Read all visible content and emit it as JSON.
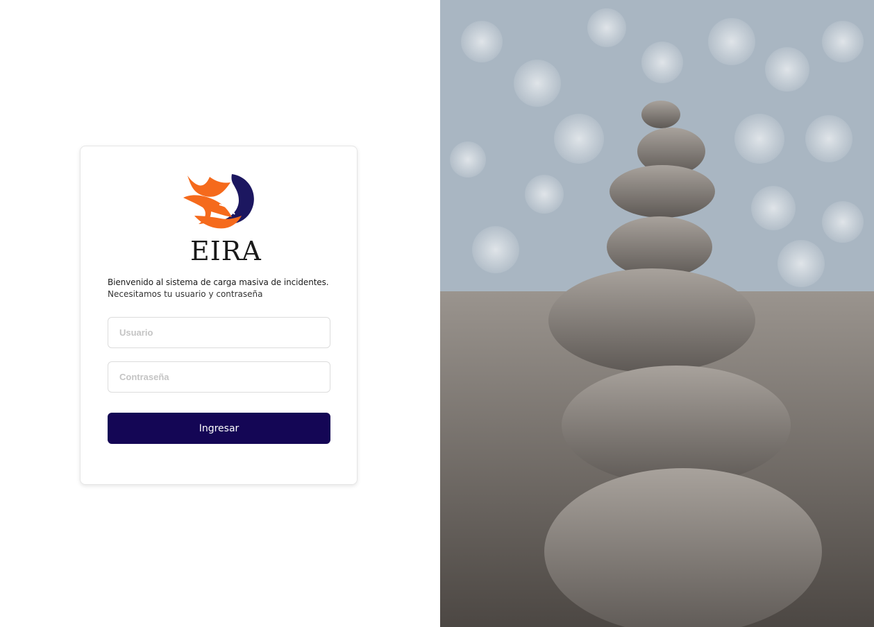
{
  "brand": {
    "name": "EIRA",
    "orange": "#f56a1c",
    "navy": "#1c1760"
  },
  "login": {
    "welcome": "Bienvenido al sistema de carga masiva de incidentes.",
    "subtitle": "Necesitamos tu usuario y contraseña",
    "username_placeholder": "Usuario",
    "password_placeholder": "Contraseña",
    "submit_label": "Ingresar",
    "button_color": "#140655"
  },
  "photo": {
    "subject": "stacked-stones"
  }
}
